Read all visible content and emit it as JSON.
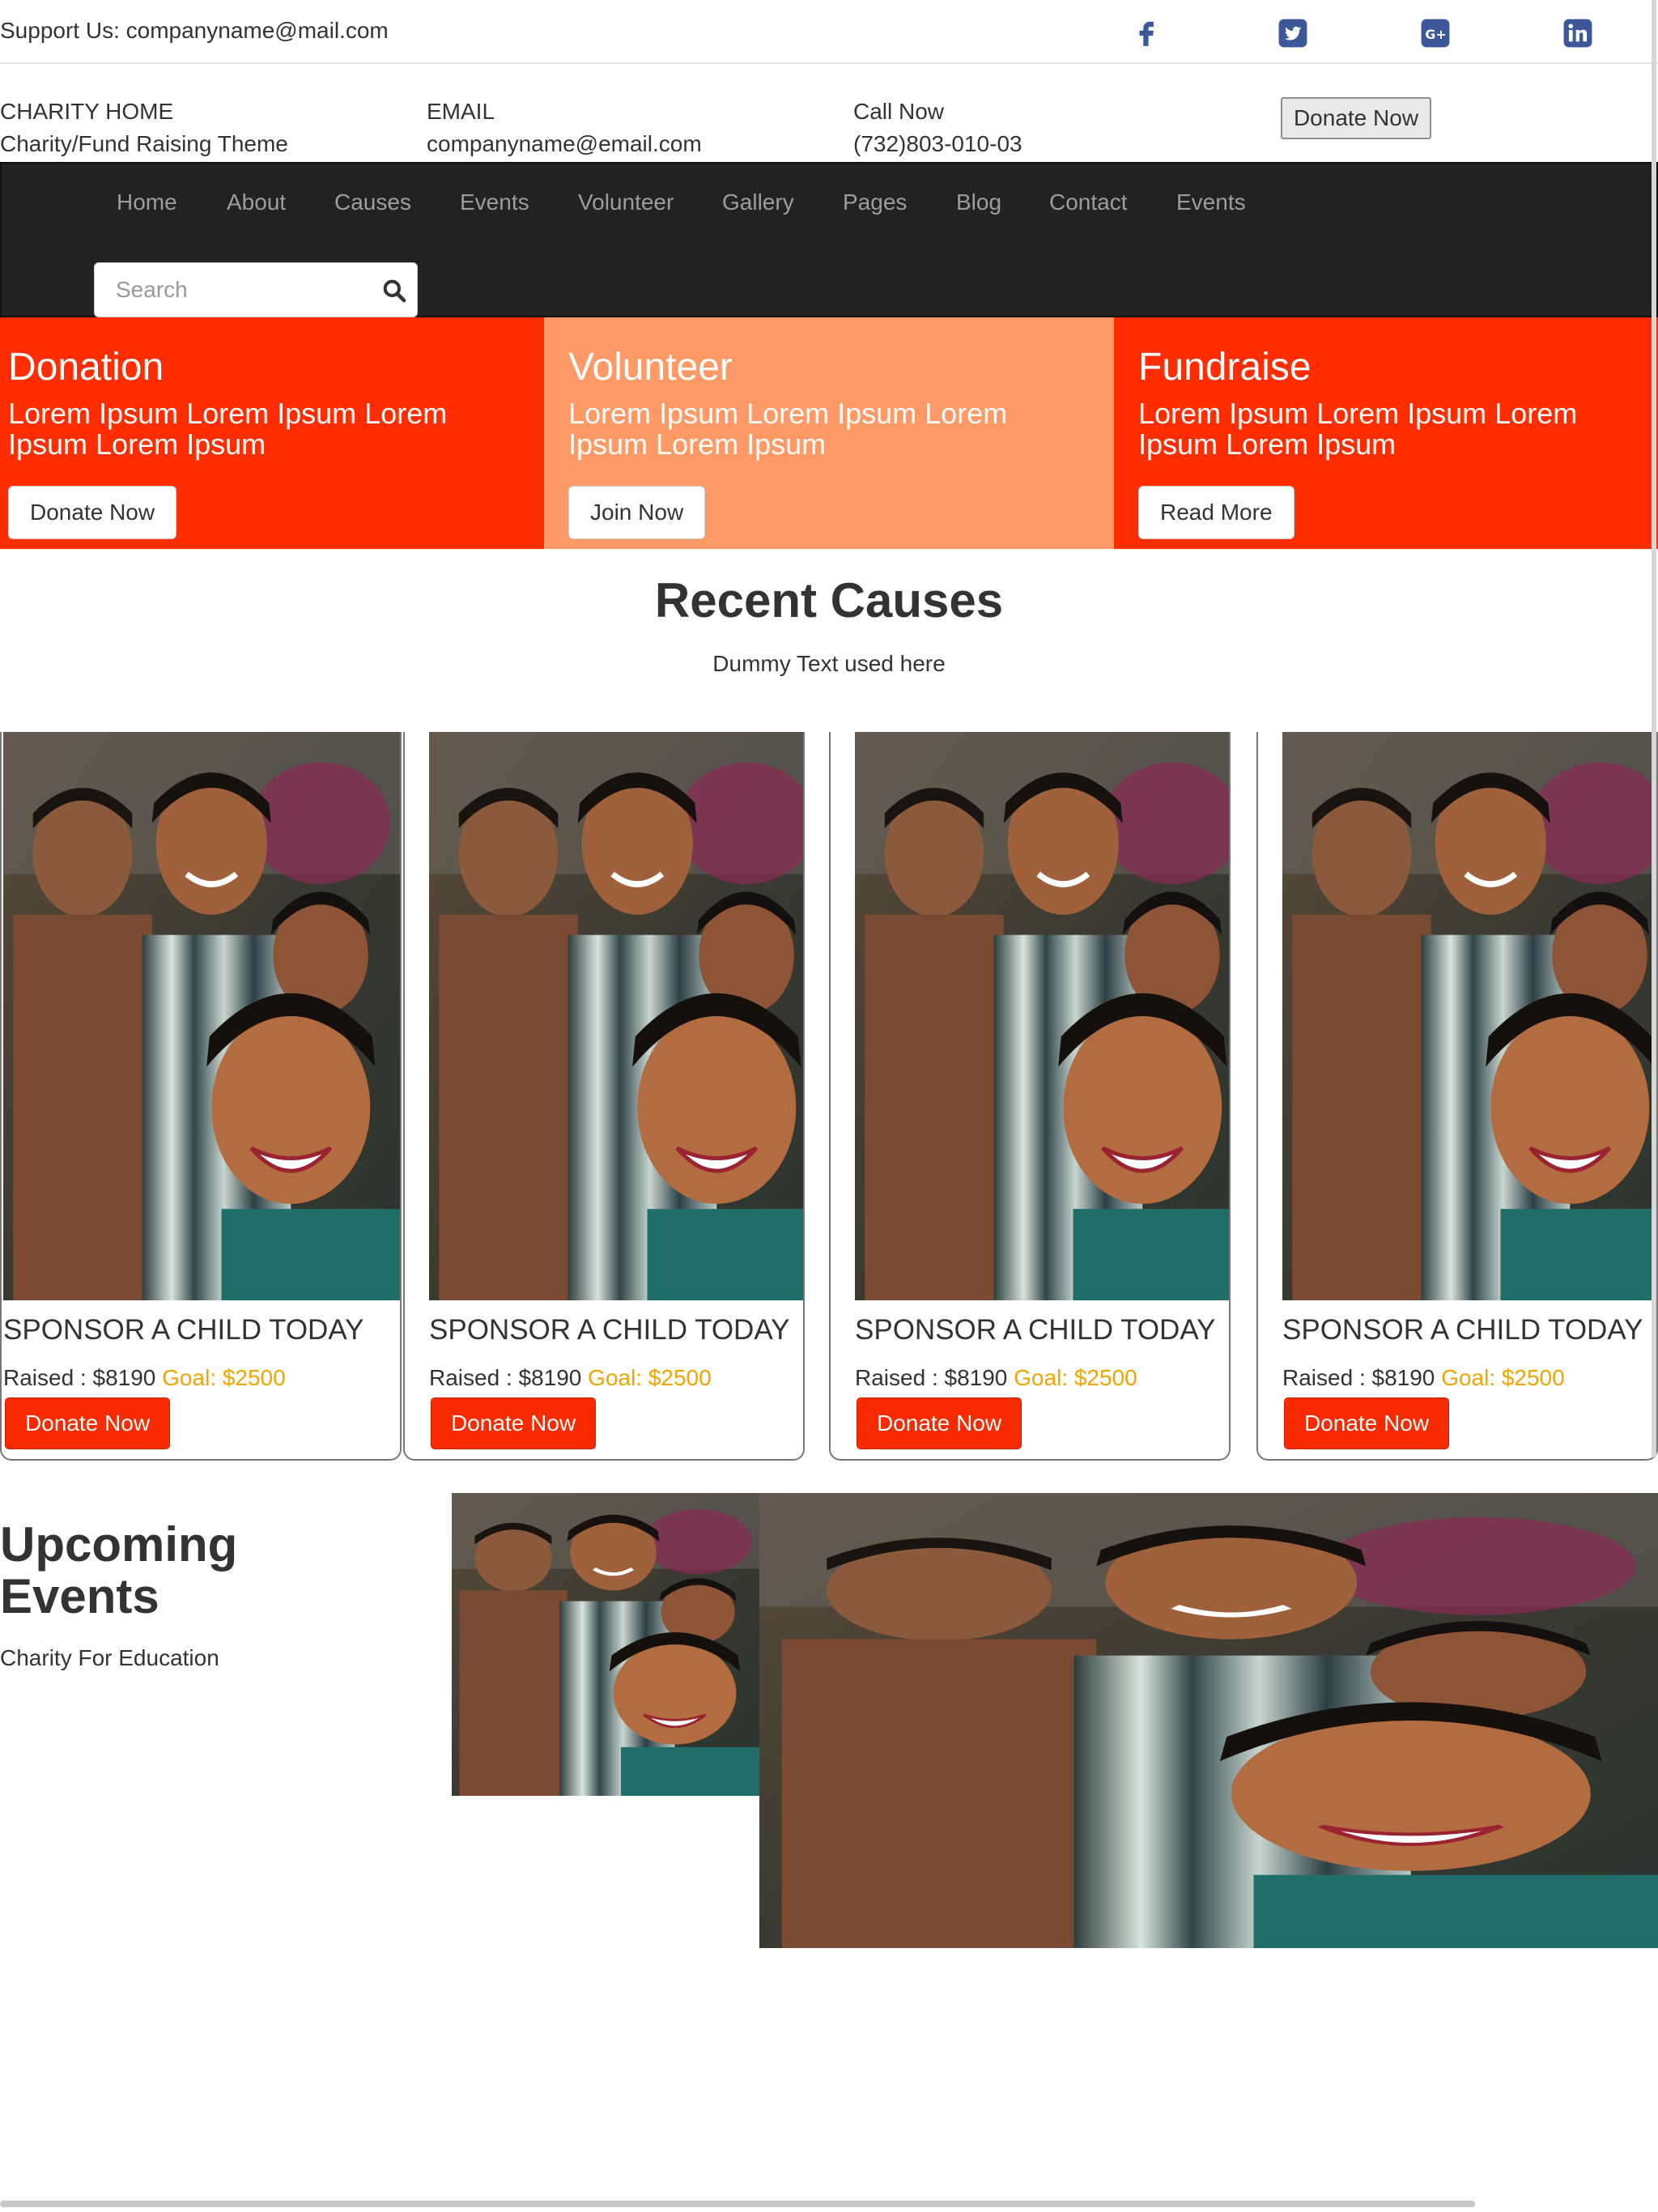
{
  "support": {
    "text": "Support Us: companyname@mail.com"
  },
  "social": [
    {
      "icon": "facebook-icon",
      "color": "#3b5998"
    },
    {
      "icon": "twitter-icon",
      "color": "#3b5998"
    },
    {
      "icon": "google-plus-icon",
      "color": "#3b5998"
    },
    {
      "icon": "linkedin-icon",
      "color": "#3b5998"
    }
  ],
  "contact": {
    "home_label": "CHARITY HOME",
    "home_sub": "Charity/Fund Raising Theme",
    "email_label": "EMAIL",
    "email_value": "companyname@email.com",
    "call_label": "Call Now",
    "call_value": "(732)803-010-03",
    "donate_label": "Donate Now"
  },
  "nav": {
    "items": [
      "Home",
      "About",
      "Causes",
      "Events",
      "Volunteer",
      "Gallery",
      "Pages",
      "Blog",
      "Contact",
      "Events"
    ],
    "search_placeholder": "Search"
  },
  "features": [
    {
      "title": "Donation",
      "text": "Lorem Ipsum Lorem Ipsum Lorem Ipsum Lorem Ipsum",
      "button": "Donate Now",
      "color": "#ff2d00"
    },
    {
      "title": "Volunteer",
      "text": "Lorem Ipsum Lorem Ipsum Lorem Ipsum Lorem Ipsum",
      "button": "Join Now",
      "color": "#ff9966"
    },
    {
      "title": "Fundraise",
      "text": "Lorem Ipsum Lorem Ipsum Lorem Ipsum Lorem Ipsum",
      "button": "Read More",
      "color": "#ff2d00"
    }
  ],
  "causes": {
    "title": "Recent Causes",
    "subtitle": "Dummy Text used here",
    "cards": [
      {
        "title": "SPONSOR A CHILD TODAY",
        "raised": "Raised : $8190",
        "goal": "Goal: $2500",
        "button": "Donate Now"
      },
      {
        "title": "SPONSOR A CHILD TODAY",
        "raised": "Raised : $8190",
        "goal": "Goal: $2500",
        "button": "Donate Now"
      },
      {
        "title": "SPONSOR A CHILD TODAY",
        "raised": "Raised : $8190",
        "goal": "Goal: $2500",
        "button": "Donate Now"
      },
      {
        "title": "SPONSOR A CHILD TODAY",
        "raised": "Raised : $8190",
        "goal": "Goal: $2500",
        "button": "Donate Now"
      }
    ]
  },
  "events": {
    "title": "Upcoming Events",
    "subtitle": "Charity For Education"
  }
}
